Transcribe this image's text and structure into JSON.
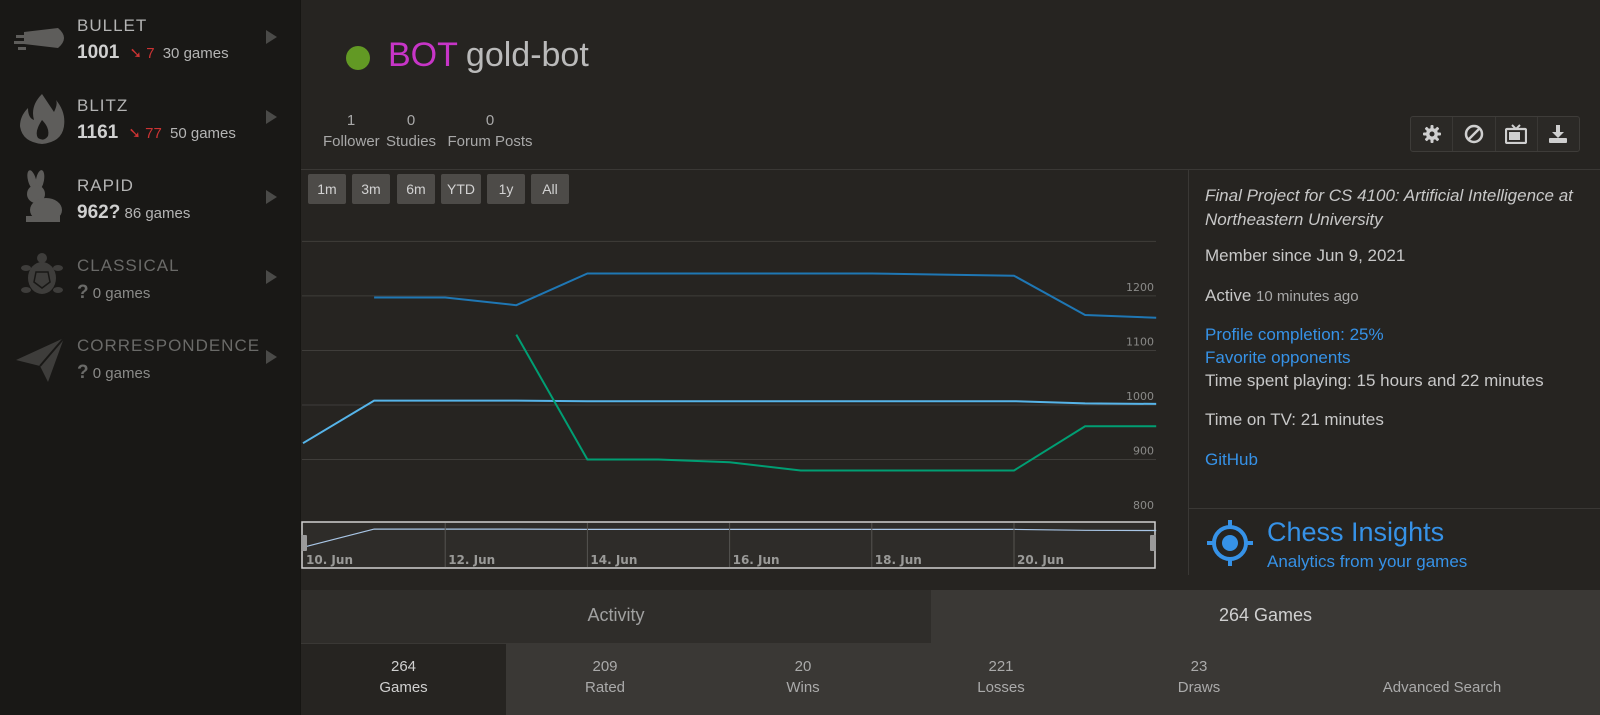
{
  "sidebar": {
    "perfs": [
      {
        "name": "BULLET",
        "rating": "1001",
        "delta": "7",
        "games": "30 games",
        "icon": "bullet-icon"
      },
      {
        "name": "BLITZ",
        "rating": "1161",
        "delta": "77",
        "games": "50 games",
        "icon": "blitz-flame-icon"
      },
      {
        "name": "RAPID",
        "rating": "962?",
        "games": "86 games",
        "icon": "rapid-rabbit-icon"
      },
      {
        "name": "CLASSICAL",
        "rating": "?",
        "games": "0 games",
        "icon": "classical-turtle-icon"
      },
      {
        "name": "CORRESPONDENCE",
        "rating": "?",
        "games": "0 games",
        "icon": "correspondence-paper-plane-icon"
      }
    ]
  },
  "header": {
    "title_prefix": "BOT",
    "username": "gold-bot",
    "online_color": "#629924",
    "stats": [
      {
        "count": "1",
        "label": "Follower"
      },
      {
        "count": "0",
        "label": "Studies"
      },
      {
        "count": "0",
        "label": "Forum Posts"
      }
    ],
    "toolbar_icons": [
      "gear-icon",
      "block-icon",
      "tv-icon",
      "download-icon"
    ]
  },
  "chart": {
    "range_buttons": [
      "1m",
      "3m",
      "6m",
      "YTD",
      "1y",
      "All"
    ]
  },
  "chart_data": {
    "type": "line",
    "x": [
      "10. Jun",
      "11. Jun",
      "12. Jun",
      "13. Jun",
      "14. Jun",
      "15. Jun",
      "16. Jun",
      "17. Jun",
      "18. Jun",
      "19. Jun",
      "20. Jun",
      "21. Jun",
      "22. Jun"
    ],
    "x_ticks": [
      "10. Jun",
      "12. Jun",
      "14. Jun",
      "16. Jun",
      "18. Jun",
      "20. Jun"
    ],
    "y_ticks": [
      800,
      900,
      1000,
      1100,
      1200
    ],
    "ylim": [
      780,
      1330
    ],
    "grid": true,
    "series": [
      {
        "color": "#1f77b4",
        "points": [
          [
            1,
            1197
          ],
          [
            2,
            1197
          ],
          [
            3,
            1183
          ],
          [
            4,
            1241
          ],
          [
            8,
            1241
          ],
          [
            9,
            1239
          ],
          [
            10,
            1237
          ],
          [
            11,
            1165
          ],
          [
            12,
            1160
          ]
        ]
      },
      {
        "color": "#56b4e9",
        "points": [
          [
            0,
            930
          ],
          [
            1,
            1008
          ],
          [
            3,
            1008
          ],
          [
            4,
            1007
          ],
          [
            10,
            1007
          ],
          [
            11,
            1003
          ],
          [
            12,
            1002
          ]
        ]
      },
      {
        "color": "#009e73",
        "points": [
          [
            3,
            1129
          ],
          [
            4,
            900
          ],
          [
            5,
            900
          ],
          [
            6,
            895
          ],
          [
            7,
            880
          ],
          [
            10,
            880
          ],
          [
            11,
            961
          ],
          [
            12,
            961
          ]
        ]
      }
    ]
  },
  "info": {
    "bio": "Final Project for CS 4100: Artificial Intelligence at Northeastern University",
    "member_since": "Member since Jun 9, 2021",
    "active_label": "Active",
    "active_time": "10 minutes ago",
    "profile_completion": "Profile completion: 25%",
    "favorite_opponents": "Favorite opponents",
    "time_playing": "Time spent playing: 15 hours and 22 minutes",
    "time_tv": "Time on TV: 21 minutes",
    "github": "GitHub",
    "insights_title": "Chess Insights",
    "insights_sub": "Analytics from your games"
  },
  "tabs": {
    "activity": "Activity",
    "games": "264 Games"
  },
  "filters": [
    {
      "count": "264",
      "label": "Games",
      "active": true
    },
    {
      "count": "209",
      "label": "Rated"
    },
    {
      "count": "20",
      "label": "Wins"
    },
    {
      "count": "221",
      "label": "Losses"
    },
    {
      "count": "23",
      "label": "Draws"
    },
    {
      "count": "",
      "label": "Advanced Search"
    }
  ]
}
